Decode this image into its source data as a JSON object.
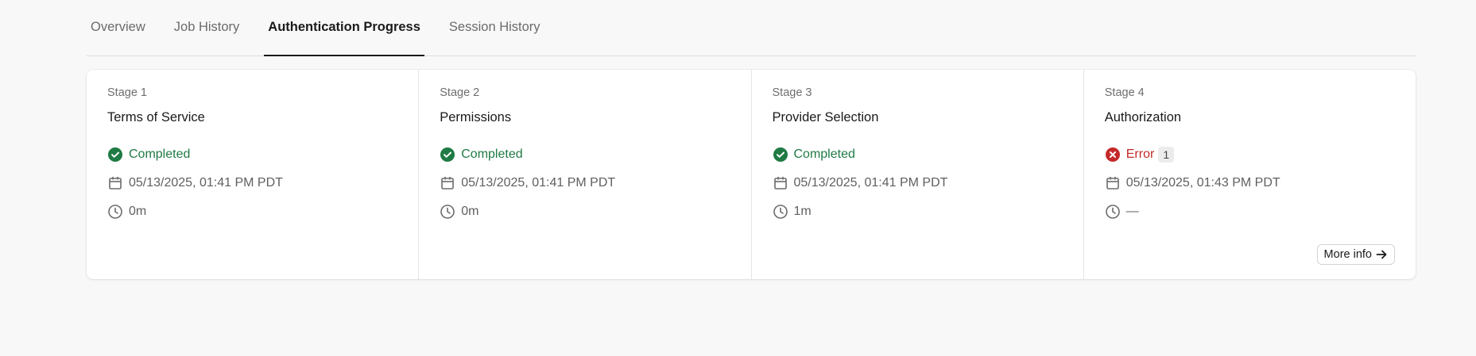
{
  "tabs": [
    {
      "label": "Overview",
      "active": false
    },
    {
      "label": "Job History",
      "active": false
    },
    {
      "label": "Authentication Progress",
      "active": true
    },
    {
      "label": "Session History",
      "active": false
    }
  ],
  "stages": [
    {
      "number": "Stage 1",
      "title": "Terms of Service",
      "status": "Completed",
      "status_type": "success",
      "timestamp": "05/13/2025, 01:41 PM PDT",
      "duration": "0m"
    },
    {
      "number": "Stage 2",
      "title": "Permissions",
      "status": "Completed",
      "status_type": "success",
      "timestamp": "05/13/2025, 01:41 PM PDT",
      "duration": "0m"
    },
    {
      "number": "Stage 3",
      "title": "Provider Selection",
      "status": "Completed",
      "status_type": "success",
      "timestamp": "05/13/2025, 01:41 PM PDT",
      "duration": "1m"
    },
    {
      "number": "Stage 4",
      "title": "Authorization",
      "status": "Error",
      "status_type": "error",
      "error_count": "1",
      "timestamp": "05/13/2025, 01:43 PM PDT",
      "duration": "—",
      "more_info_label": "More info"
    }
  ],
  "colors": {
    "success": "#1f7a44",
    "error": "#c42a2a",
    "active_tab": "#1a1a1a"
  },
  "icons": {
    "success": "check-circle-icon",
    "error": "x-circle-icon",
    "date": "calendar-icon",
    "duration": "clock-icon",
    "more": "arrow-right-icon"
  }
}
